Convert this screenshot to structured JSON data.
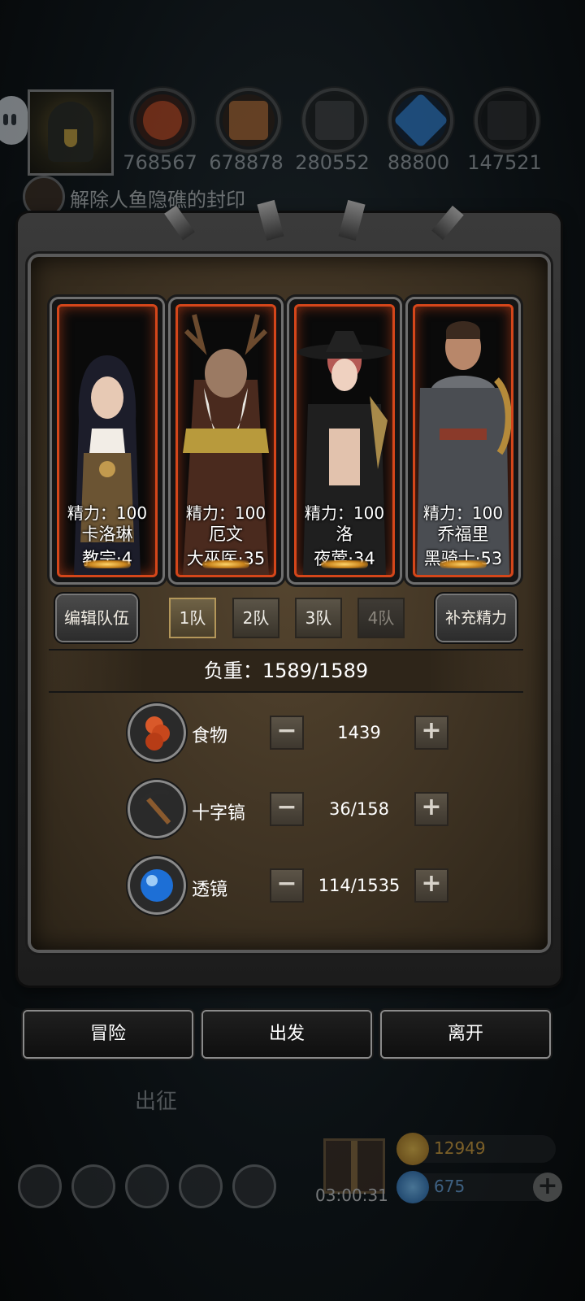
{
  "resources": [
    {
      "name": "food",
      "value": "768567",
      "color": "#b8441d"
    },
    {
      "name": "wood",
      "value": "678878",
      "color": "#a8632d"
    },
    {
      "name": "iron",
      "value": "280552",
      "color": "#3b3b3b"
    },
    {
      "name": "crystal",
      "value": "88800",
      "color": "#2c79c9"
    },
    {
      "name": "ore",
      "value": "147521",
      "color": "#2b2b2b"
    }
  ],
  "quest": {
    "text": "解除人鱼隐礁的封印"
  },
  "heroes": [
    {
      "energy": "精力：100",
      "name": "卡洛琳",
      "class": "教宗·4"
    },
    {
      "energy": "精力：100",
      "name": "厄文",
      "class": "大巫医·35"
    },
    {
      "energy": "精力：100",
      "name": "洛",
      "class": "夜莺·34"
    },
    {
      "energy": "精力：100",
      "name": "乔福里",
      "class": "黑骑士·53"
    }
  ],
  "team": {
    "edit_label": "编辑队伍",
    "refill_label": "补充精力",
    "tabs": [
      "1队",
      "2队",
      "3队",
      "4队"
    ]
  },
  "weight": {
    "label": "负重：1589/1589"
  },
  "supplies": [
    {
      "label": "食物",
      "value": "1439"
    },
    {
      "label": "十字镐",
      "value": "36/158"
    },
    {
      "label": "透镜",
      "value": "114/1535"
    }
  ],
  "step": {
    "minus": "−",
    "plus": "+"
  },
  "actions": {
    "adventure": "冒险",
    "depart": "出发",
    "leave": "离开"
  },
  "bottom": {
    "march_label": "出征",
    "timer": "03:00:31",
    "gold": "12949",
    "gems": "675",
    "plus": "+"
  }
}
